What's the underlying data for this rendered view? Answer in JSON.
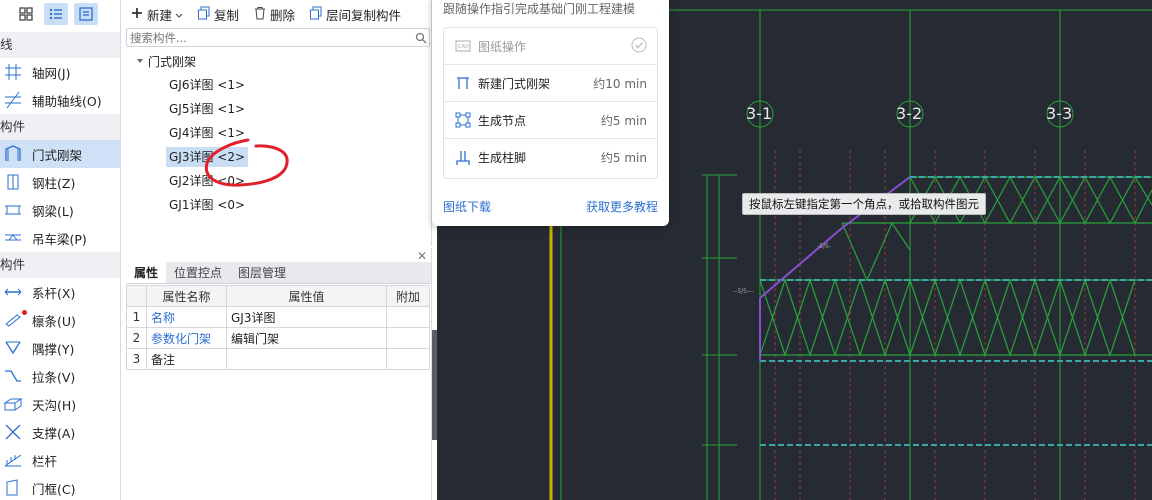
{
  "nav": {
    "categories": {
      "line": "线",
      "component1": "构件",
      "component2": "构件"
    },
    "items": [
      {
        "label": "轴网(J)"
      },
      {
        "label": "辅助轴线(O)"
      },
      {
        "label": "门式刚架"
      },
      {
        "label": "钢柱(Z)"
      },
      {
        "label": "钢梁(L)"
      },
      {
        "label": "吊车梁(P)"
      },
      {
        "label": "系杆(X)"
      },
      {
        "label": "檩条(U)"
      },
      {
        "label": "隅撑(Y)"
      },
      {
        "label": "拉条(V)"
      },
      {
        "label": "天沟(H)"
      },
      {
        "label": "支撑(A)"
      },
      {
        "label": "栏杆"
      },
      {
        "label": "门框(C)"
      }
    ]
  },
  "toolbar": {
    "new": "新建",
    "copy": "复制",
    "delete": "删除",
    "floor_copy": "层间复制构件"
  },
  "search": {
    "placeholder": "搜索构件..."
  },
  "tree": {
    "root": "门式刚架",
    "nodes": [
      "GJ6详图 <1>",
      "GJ5详图 <1>",
      "GJ4详图 <1>",
      "GJ3详图 <2>",
      "GJ2详图 <0>",
      "GJ1详图 <0>"
    ]
  },
  "props": {
    "tabs": [
      "属性",
      "位置控点",
      "图层管理"
    ],
    "headers": [
      "属性名称",
      "属性值",
      "附加"
    ],
    "rows": [
      {
        "num": "1",
        "name": "名称",
        "value": "GJ3详图"
      },
      {
        "num": "2",
        "name": "参数化门架",
        "value": "编辑门架"
      },
      {
        "num": "3",
        "name": "备注",
        "value": ""
      }
    ]
  },
  "guide": {
    "title": "跟随操作指引完成基础门刚工程建模",
    "steps": [
      {
        "label": "图纸操作",
        "duration": ""
      },
      {
        "label": "新建门式刚架",
        "duration": "约10 min"
      },
      {
        "label": "生成节点",
        "duration": "约5 min"
      },
      {
        "label": "生成柱脚",
        "duration": "约5 min"
      }
    ],
    "download": "图纸下载",
    "more": "获取更多教程"
  },
  "cad": {
    "axes": [
      "3-1",
      "3-2",
      "3-3"
    ],
    "tooltip": "按鼠标左键指定第一个角点，或拾取构件图元"
  },
  "colors": {
    "accent": "#2b6fd1",
    "selected": "#c9def5",
    "cad_bg": "#262b33",
    "annotation": "#e0202a"
  }
}
